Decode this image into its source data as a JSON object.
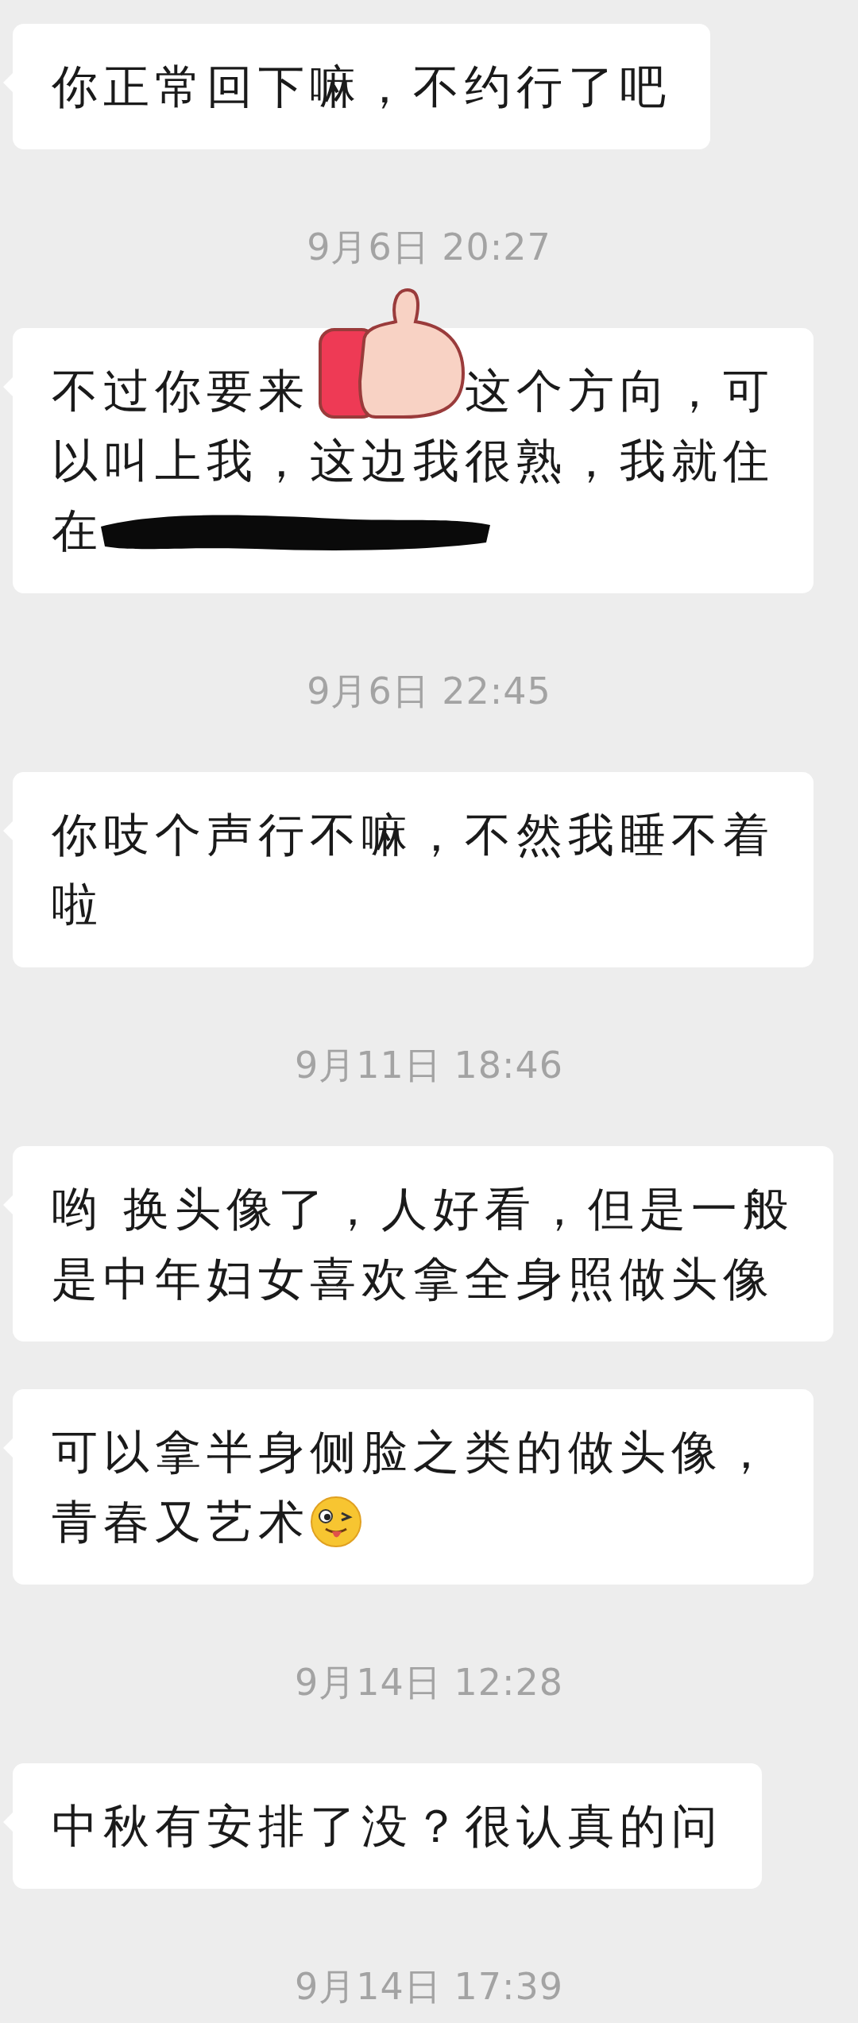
{
  "chat": [
    {
      "kind": "message",
      "lines": [
        "你正常回下嘛，不约行了吧"
      ],
      "sticker_overlay": false,
      "redacted": false,
      "trailing_emoji": false
    },
    {
      "kind": "timestamp",
      "text": "9月6日 20:27"
    },
    {
      "kind": "message",
      "lines": [
        "不过你要来　　　这个方向，可",
        "以叫上我，这边我很熟，我就住",
        "在"
      ],
      "sticker_overlay": true,
      "redacted": true,
      "trailing_emoji": false
    },
    {
      "kind": "timestamp",
      "text": "9月6日 22:45"
    },
    {
      "kind": "message",
      "lines": [
        "你吱个声行不嘛，不然我睡不着",
        "啦"
      ],
      "sticker_overlay": false,
      "redacted": false,
      "trailing_emoji": false
    },
    {
      "kind": "timestamp",
      "text": "9月11日 18:46"
    },
    {
      "kind": "message",
      "lines": [
        "哟 换头像了，人好看，但是一般",
        "是中年妇女喜欢拿全身照做头像"
      ],
      "sticker_overlay": false,
      "redacted": false,
      "trailing_emoji": false
    },
    {
      "kind": "message",
      "lines": [
        "可以拿半身侧脸之类的做头像，",
        "青春又艺术"
      ],
      "sticker_overlay": false,
      "redacted": false,
      "trailing_emoji": true
    },
    {
      "kind": "timestamp",
      "text": "9月14日 12:28"
    },
    {
      "kind": "message",
      "lines": [
        "中秋有安排了没？很认真的问"
      ],
      "sticker_overlay": false,
      "redacted": false,
      "trailing_emoji": false
    },
    {
      "kind": "timestamp",
      "text": "9月14日 17:39"
    }
  ]
}
